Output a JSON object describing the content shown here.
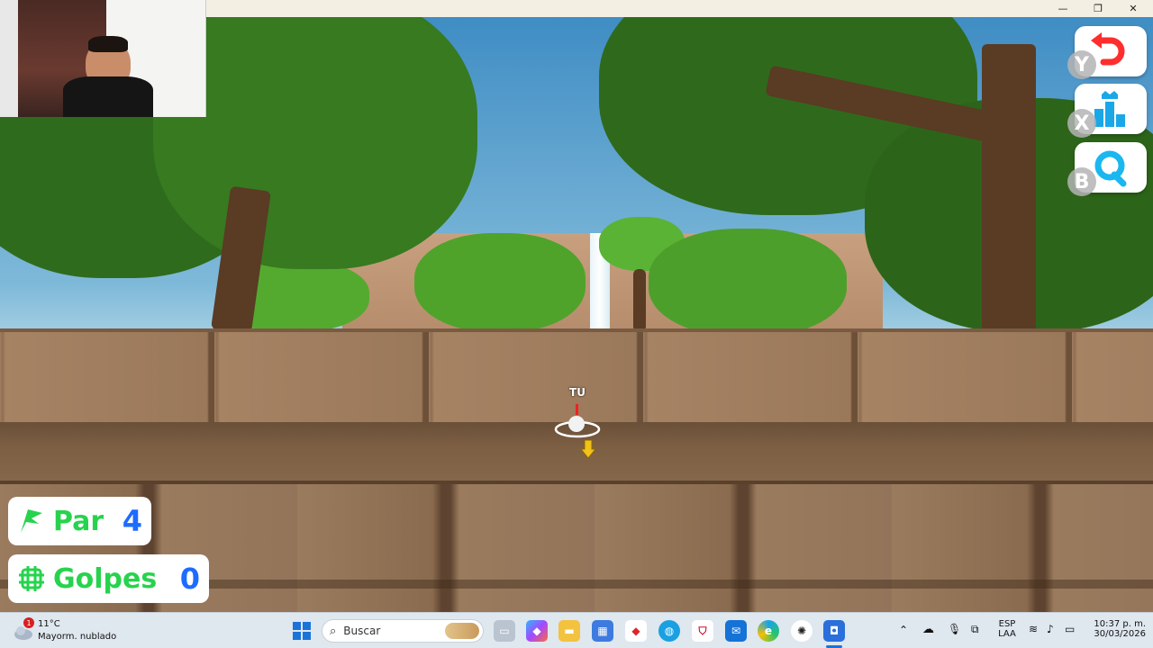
{
  "player": {
    "tag": "TU"
  },
  "hud": {
    "par_label": "Par",
    "par_value": "4",
    "strokes_label": "Golpes",
    "strokes_value": "0",
    "accent_green": "#27d34d",
    "accent_blue": "#1e6bff"
  },
  "side_buttons": [
    {
      "gamepad_key": "Y",
      "icon": "undo-arrow-icon",
      "color": "#ff2d2d"
    },
    {
      "gamepad_key": "X",
      "icon": "leaderboard-crown-icon",
      "color": "#1aa7e8"
    },
    {
      "gamepad_key": "B",
      "icon": "spectate-loop-icon",
      "color": "#1ab7f0"
    }
  ],
  "window_controls": {
    "minimize": "—",
    "maximize": "❐",
    "close": "✕"
  },
  "taskbar": {
    "weather": {
      "temp": "11°C",
      "desc": "Mayorm. nublado",
      "alert_count": "1"
    },
    "search_placeholder": "Buscar",
    "language": {
      "code": "ESP",
      "layout": "LAA"
    },
    "clock": {
      "time": "10:37 p. m.",
      "date": "30/03/2026"
    }
  }
}
